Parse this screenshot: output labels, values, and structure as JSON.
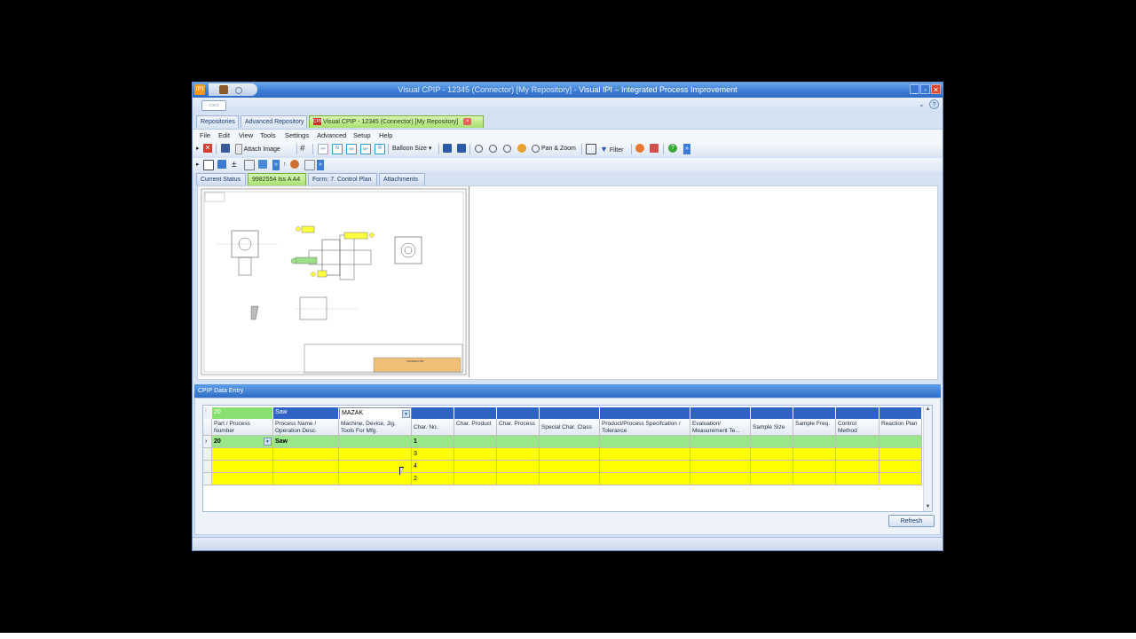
{
  "window": {
    "title_doc": "Visual CPIP - 12345 (Connector) [My Repository] - ",
    "title_app": "Visual IPI – Integrated Process Improvement",
    "orb_label": "IPI"
  },
  "doc_tabs": [
    {
      "label": "Repositories"
    },
    {
      "label": "Advanced Repository"
    },
    {
      "label": "Visual CPIP - 12345 (Connector) [My Repository]",
      "icon": "CPIP",
      "close": "×"
    }
  ],
  "menu": [
    "File",
    "Edit",
    "View",
    "Tools",
    "Settings",
    "Advanced",
    "Setup",
    "Help"
  ],
  "toolbar": {
    "attach_image": "Attach Image",
    "balloon_size": "Balloon Size",
    "pan_zoom": "Pan & Zoom",
    "filter": "Filter",
    "more": "»"
  },
  "toolbar_small_buttons": [
    "PP",
    "N",
    "NN",
    "MP",
    "R"
  ],
  "sub_tabs": [
    {
      "label": "Current Status"
    },
    {
      "label": "9982554 Iss A A4"
    },
    {
      "label": "Form: 7. Control Plan"
    },
    {
      "label": "Attachments"
    }
  ],
  "drawing": {
    "title_block": "CONNECTOR"
  },
  "panel": {
    "title": "CPIP Data Entry"
  },
  "grid": {
    "filters": [
      "20",
      "Saw",
      "MAZAK"
    ],
    "columns": [
      "Part / Process Number",
      "Process Name / Operation Desc.",
      "Machine, Device, Jig, Tools For Mfg.",
      "Char. No.",
      "Char. Product",
      "Char. Process",
      "Special Char. Class",
      "Product/Process Specifcation / Tolerance",
      "Evaluation/ Measurement Te...",
      "Sample Size",
      "Sample Freq.",
      "Control Method",
      "Reaction Plan"
    ],
    "rows": [
      {
        "part": "20",
        "process": "Saw",
        "machine": "",
        "char_no": "1",
        "style": "green",
        "indicator": "›"
      },
      {
        "part": "",
        "process": "",
        "machine": "",
        "char_no": "3",
        "style": "yellow",
        "indicator": ""
      },
      {
        "part": "",
        "process": "",
        "machine": "",
        "char_no": "4",
        "style": "yellow",
        "indicator": ""
      },
      {
        "part": "",
        "process": "",
        "machine": "",
        "char_no": "2",
        "style": "yellow",
        "indicator": ""
      }
    ]
  },
  "buttons": {
    "refresh": "Refresh"
  },
  "colors": {
    "title_bar": "#3b7dd6",
    "active_tab": "#a8e070",
    "row_green": "#9ae78a",
    "row_yellow": "#ffff00",
    "filter_row": "#2f63c5"
  }
}
